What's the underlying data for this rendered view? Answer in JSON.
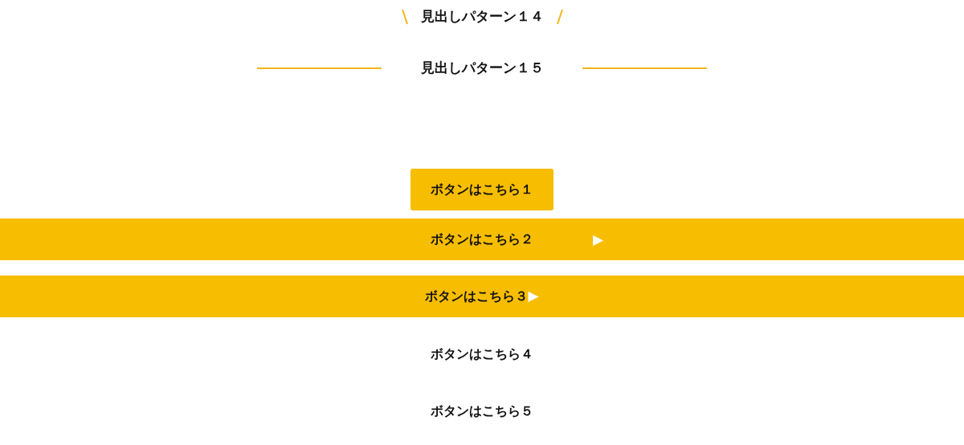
{
  "headings": [
    {
      "kind": "slashes",
      "text": "見出しパターン１４"
    },
    {
      "kind": "lines",
      "text": "見出しパターン１５"
    }
  ],
  "buttons": [
    {
      "kind": "box",
      "label": "ボタンはこちら１"
    },
    {
      "kind": "bar-far-arrow",
      "label": "ボタンはこちら２",
      "arrow": "▶"
    },
    {
      "kind": "bar-inline-arrow",
      "label": "ボタンはこちら３",
      "arrow": "▶"
    },
    {
      "kind": "plain",
      "label": "ボタンはこちら４"
    },
    {
      "kind": "plain",
      "label": "ボタンはこちら５"
    }
  ]
}
